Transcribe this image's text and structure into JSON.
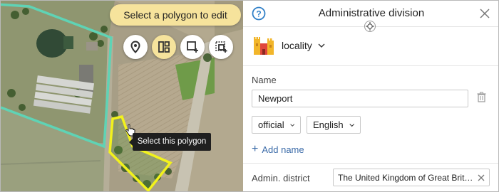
{
  "map": {
    "hint_text": "Select a polygon to edit",
    "tooltip_text": "Select this polygon",
    "tools": [
      {
        "icon": "pin-icon",
        "active": false
      },
      {
        "icon": "layout-panels-icon",
        "active": true
      },
      {
        "icon": "add-polygon-icon",
        "active": false
      },
      {
        "icon": "cut-polygon-icon",
        "active": false
      }
    ],
    "colors": {
      "teal_outline": "#5fd3b5",
      "selected_outline": "#f2f21c",
      "hint_bg": "#f6e39c"
    }
  },
  "panel": {
    "title": "Administrative division",
    "category": {
      "label": "locality",
      "icon": "castle-icon"
    },
    "name_label": "Name",
    "name_value": "Newport",
    "name_type": "official",
    "name_language": "English",
    "add_name": "Add name",
    "admin_label": "Admin. district",
    "admin_value": "The United Kingdom of Great Britain and Northern Ireland",
    "colors": {
      "link": "#3b6ba8",
      "help": "#2f7fc7"
    }
  }
}
